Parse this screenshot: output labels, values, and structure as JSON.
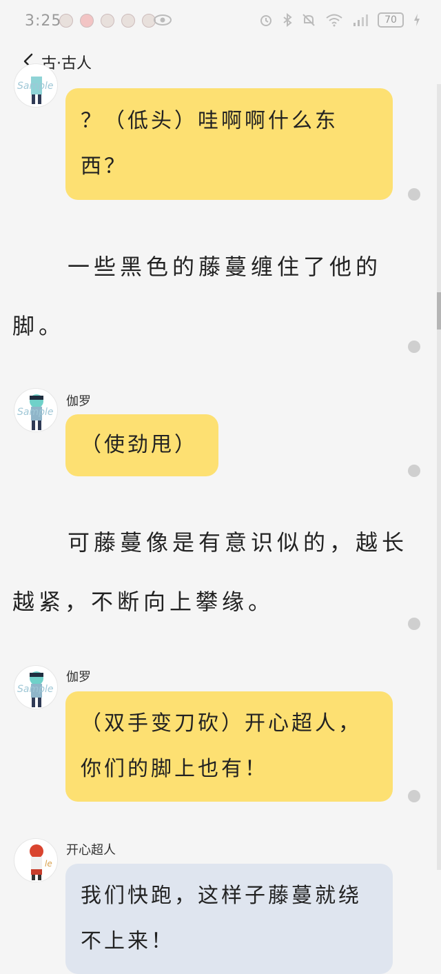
{
  "status_bar": {
    "time": "3:25",
    "battery": "70"
  },
  "nav": {
    "title": "古·古人"
  },
  "messages": [
    {
      "type": "bubble",
      "text": "？（低头）哇啊啊什么东西？"
    },
    {
      "type": "narration",
      "text": "一些黑色的藤蔓缠住了他的脚。"
    },
    {
      "type": "bubble",
      "speaker": "伽罗",
      "text": "（使劲甩）"
    },
    {
      "type": "narration",
      "text": "可藤蔓像是有意识似的，越长越紧，不断向上攀缘。"
    },
    {
      "type": "bubble",
      "speaker": "伽罗",
      "text": "（双手变刀砍）开心超人，你们的脚上也有！"
    },
    {
      "type": "bubble",
      "speaker": "开心超人",
      "text": "我们快跑，这样子藤蔓就绕不上来！"
    }
  ]
}
